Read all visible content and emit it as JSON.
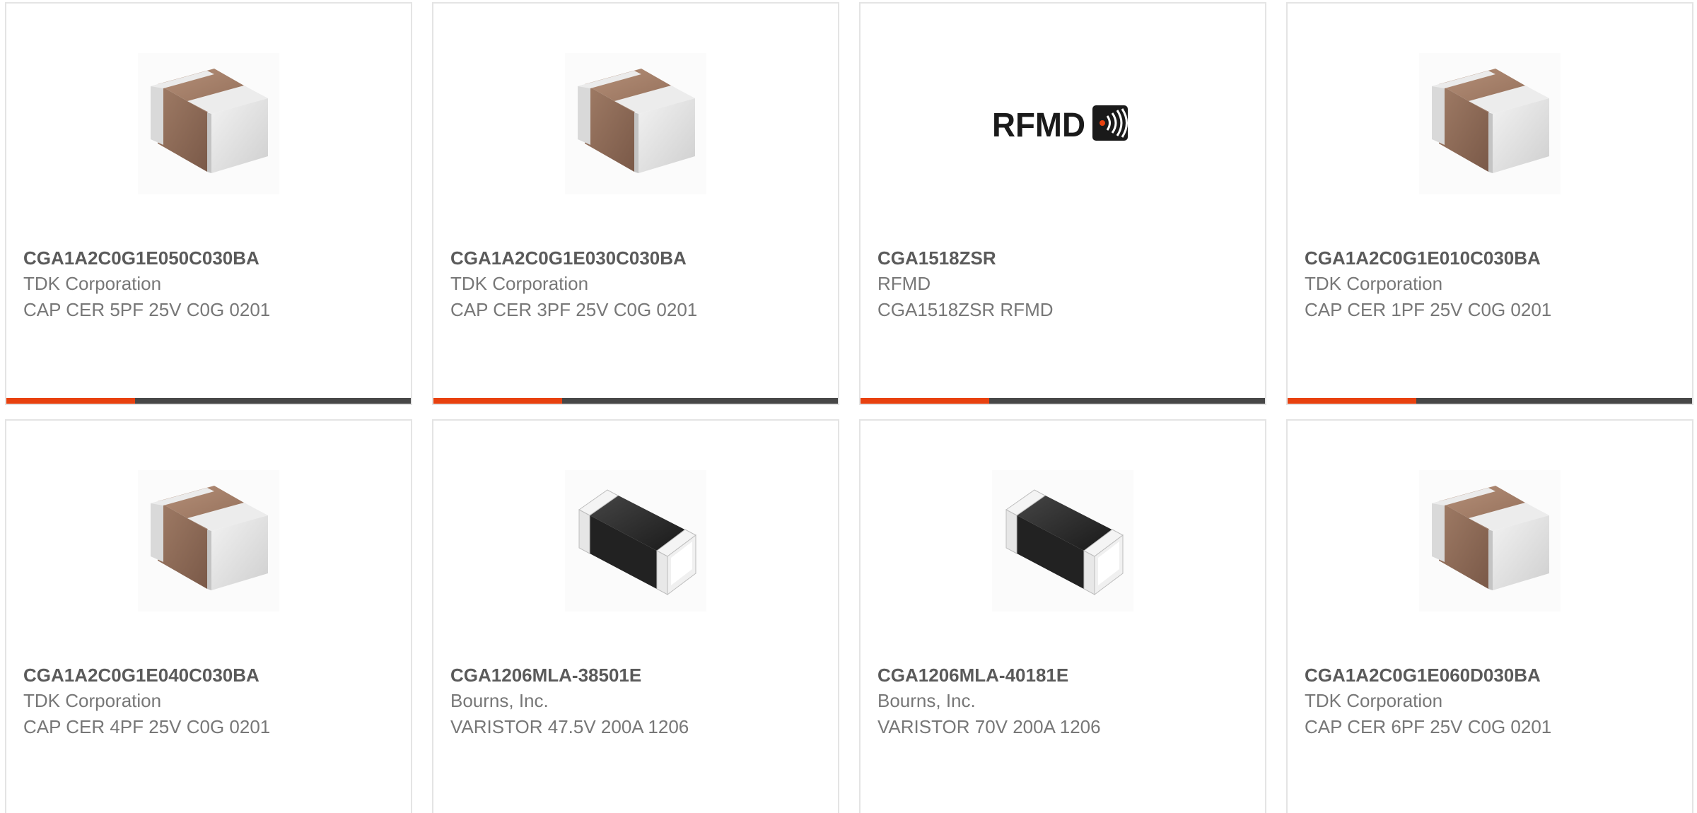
{
  "colors": {
    "accent": "#e8410f",
    "bar": "#474747",
    "title": "#5a5a5a",
    "text": "#777777"
  },
  "products": [
    {
      "part_number": "CGA1A2C0G1E050C030BA",
      "manufacturer": "TDK Corporation",
      "description": "CAP CER 5PF 25V C0G 0201",
      "image": "ceramic-capacitor-icon"
    },
    {
      "part_number": "CGA1A2C0G1E030C030BA",
      "manufacturer": "TDK Corporation",
      "description": "CAP CER 3PF 25V C0G 0201",
      "image": "ceramic-capacitor-icon"
    },
    {
      "part_number": "CGA1518ZSR",
      "manufacturer": "RFMD",
      "description": "CGA1518ZSR RFMD",
      "image": "rfmd-logo",
      "logo_text": "RFMD"
    },
    {
      "part_number": "CGA1A2C0G1E010C030BA",
      "manufacturer": "TDK Corporation",
      "description": "CAP CER 1PF 25V C0G 0201",
      "image": "ceramic-capacitor-icon"
    },
    {
      "part_number": "CGA1A2C0G1E040C030BA",
      "manufacturer": "TDK Corporation",
      "description": "CAP CER 4PF 25V C0G 0201",
      "image": "ceramic-capacitor-icon"
    },
    {
      "part_number": "CGA1206MLA-38501E",
      "manufacturer": "Bourns, Inc.",
      "description": "VARISTOR 47.5V 200A 1206",
      "image": "chip-varistor-icon"
    },
    {
      "part_number": "CGA1206MLA-40181E",
      "manufacturer": "Bourns, Inc.",
      "description": "VARISTOR 70V 200A 1206",
      "image": "chip-varistor-icon"
    },
    {
      "part_number": "CGA1A2C0G1E060D030BA",
      "manufacturer": "TDK Corporation",
      "description": "CAP CER 6PF 25V C0G 0201",
      "image": "ceramic-capacitor-icon"
    }
  ]
}
